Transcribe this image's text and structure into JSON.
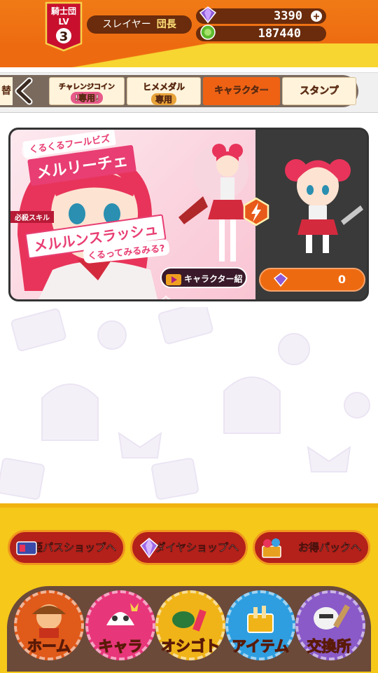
{
  "header": {
    "guild_badge": {
      "line1": "騎士団",
      "line2": "LV",
      "level": "3"
    },
    "player_name": "スレイヤー",
    "player_rank": "団長",
    "diamonds": "3390",
    "coins": "187440",
    "colors": {
      "orange": "#ee6a10",
      "brown": "#6a2c0c"
    }
  },
  "tabs": [
    {
      "label": "替",
      "icon": "back-arrow-icon"
    },
    {
      "line1": "チャレンジコイン",
      "line2": "!専用!"
    },
    {
      "line1": "ヒメメダル",
      "line2": "専用"
    },
    {
      "label": "キャラクター",
      "selected": true
    },
    {
      "label": "スタンプ"
    }
  ],
  "card": {
    "subtitle": "くるくるフールビズ",
    "name": "メルリーチェ",
    "skill_tag": "必殺スキル",
    "skill_name": "メルルンスラッシュ",
    "skill_quote": "くるってみるみる?",
    "intro_button": "キャラクター紹介",
    "price": "0"
  },
  "shop_buttons": [
    {
      "label": "姫パスショップへ",
      "icon": "pass-ticket-icon"
    },
    {
      "label": "ダイヤショップへ",
      "icon": "diamond-pile-icon"
    },
    {
      "label": "お得パックへ",
      "icon": "treasure-pack-icon"
    }
  ],
  "nav": [
    {
      "label": "ホーム",
      "color": "#e05a1a"
    },
    {
      "label": "キャラ",
      "color": "#e8367a"
    },
    {
      "label": "オシゴト",
      "color": "#f0b418"
    },
    {
      "label": "アイテム",
      "color": "#2e9ee0"
    },
    {
      "label": "交換所",
      "color": "#8a5ac8"
    }
  ]
}
